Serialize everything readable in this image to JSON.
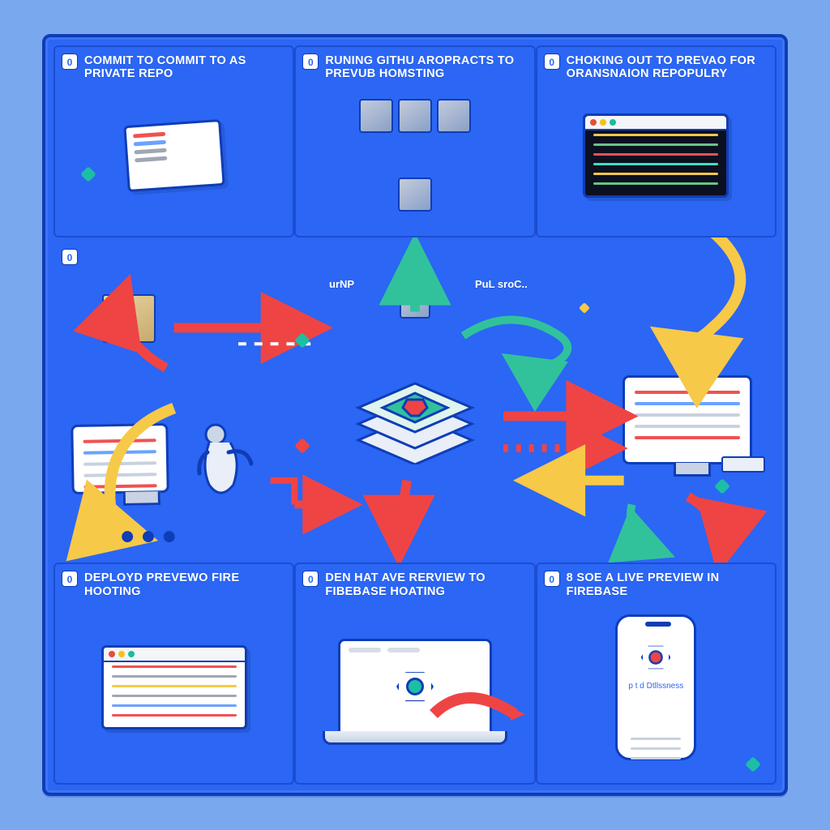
{
  "colors": {
    "bg": "#7aa8ee",
    "board": "#2b66f4",
    "border": "#0f3db6",
    "accent_red": "#f05252",
    "accent_yellow": "#f7c948",
    "accent_teal": "#1cbfa4"
  },
  "panels": {
    "top_left": {
      "badge": "0",
      "caption": "Commit to commit to as private repo"
    },
    "top_center": {
      "badge": "0",
      "caption": "Runing githu aropracts to preVub homsting"
    },
    "top_right": {
      "badge": "0",
      "caption": "Choking out to prevao for oransnaion repopulry"
    },
    "bottom_left": {
      "badge": "0",
      "caption": "Deployd prevewo Fire hooting"
    },
    "bottom_center": {
      "badge": "0",
      "caption": "Den hat ave rerview to Fibebase hoating"
    },
    "bottom_right": {
      "badge": "0",
      "caption": "8 Soe a live preview in Firebase"
    }
  },
  "center_labels": {
    "left": "urNP",
    "right": "PuL sroC.."
  },
  "phone": {
    "sub": "p t d Dtllssness"
  },
  "icons": {
    "top_left": "browser-tilt-icon",
    "top_center": "package-stack-icon",
    "top_right": "terminal-icon",
    "bottom_left": "code-window-icon",
    "bottom_center": "laptop-icon",
    "bottom_right": "phone-preview-icon",
    "center_hub": "stack-hub-icon",
    "center_left_box": "package-icon",
    "center_right_monitor": "monitor-icon",
    "center_character": "character-icon"
  }
}
